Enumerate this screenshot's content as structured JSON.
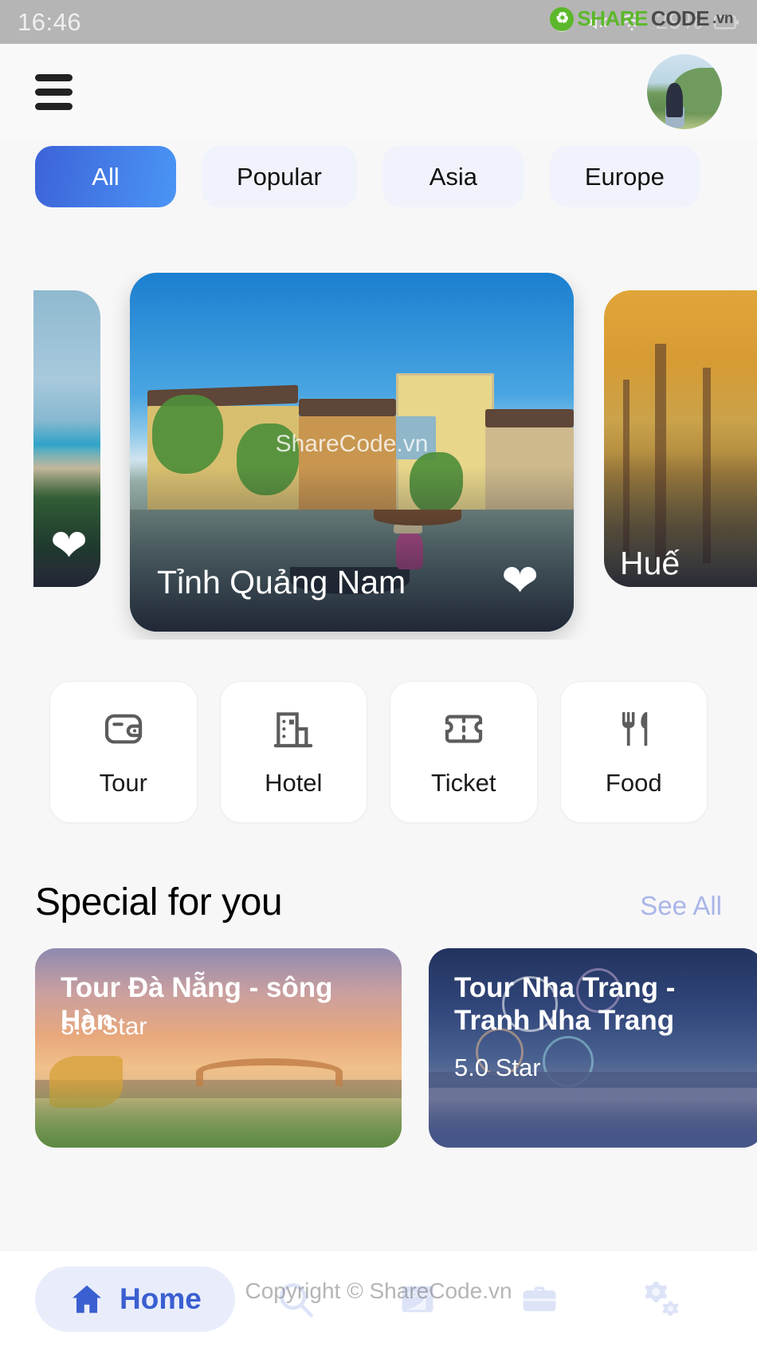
{
  "status_bar": {
    "time": "16:46",
    "battery": "29%",
    "icons": [
      "alarm-icon",
      "mute-icon",
      "wifi-icon",
      "signal-icon",
      "battery-icon"
    ],
    "watermark": {
      "share": "SHARE",
      "code": "CODE",
      "vn": ".vn"
    }
  },
  "topbar": {
    "menu_icon": "hamburger-menu-icon",
    "avatar_alt": "user-avatar"
  },
  "chips": [
    {
      "label": "All",
      "active": true
    },
    {
      "label": "Popular",
      "active": false
    },
    {
      "label": "Asia",
      "active": false
    },
    {
      "label": "Europe",
      "active": false
    }
  ],
  "carousel": {
    "watermark": "ShareCode.vn",
    "slides": [
      {
        "title": "",
        "favorite": true,
        "scene": "beach"
      },
      {
        "title": "Tỉnh Quảng Nam",
        "favorite": true,
        "scene": "hoi-an-river"
      },
      {
        "title": "Huế",
        "favorite": false,
        "scene": "autumn-forest"
      }
    ]
  },
  "quick_actions": [
    {
      "label": "Tour",
      "icon": "wallet-icon"
    },
    {
      "label": "Hotel",
      "icon": "building-icon"
    },
    {
      "label": "Ticket",
      "icon": "ticket-icon"
    },
    {
      "label": "Food",
      "icon": "fork-knife-icon"
    }
  ],
  "special_section": {
    "title": "Special for you",
    "see_all": "See All",
    "cards": [
      {
        "title": "Tour Đà Nẵng - sông Hàn",
        "rating": "5.0 Star"
      },
      {
        "title": "Tour Nha Trang - Tranh Nha Trang",
        "rating": "5.0 Star"
      }
    ]
  },
  "bottom_nav": {
    "watermark": "Copyright © ShareCode.vn",
    "items": [
      {
        "label": "Home",
        "icon": "home-icon",
        "active": true
      },
      {
        "label": "",
        "icon": "search-icon",
        "active": false
      },
      {
        "label": "",
        "icon": "discover-icon",
        "active": false
      },
      {
        "label": "",
        "icon": "briefcase-icon",
        "active": false
      },
      {
        "label": "",
        "icon": "settings-gears-icon",
        "active": false
      }
    ]
  },
  "colors": {
    "accent": "#3a5fd0",
    "chip_gradient_start": "#3d63d8",
    "chip_gradient_end": "#4a95f5",
    "see_all": "#a9b6e8",
    "nav_inactive": "#dde3f7",
    "page_bg": "#f7f7f8"
  }
}
